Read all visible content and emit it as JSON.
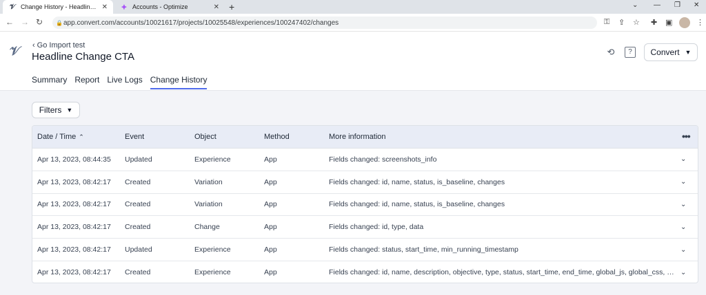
{
  "browser": {
    "tabs": [
      {
        "title": "Change History - Headline Change CTA",
        "active": true
      },
      {
        "title": "Accounts - Optimize",
        "active": false
      }
    ],
    "new_tab": "+",
    "url": "app.convert.com/accounts/10021617/projects/10025548/experiences/100247402/changes"
  },
  "header": {
    "back_label": "Go Import test",
    "title": "Headline Change CTA",
    "convert_button": "Convert"
  },
  "tabs": [
    {
      "label": "Summary",
      "active": false
    },
    {
      "label": "Report",
      "active": false
    },
    {
      "label": "Live Logs",
      "active": false
    },
    {
      "label": "Change History",
      "active": true
    }
  ],
  "filters_label": "Filters",
  "table": {
    "columns": [
      "Date / Time",
      "Event",
      "Object",
      "Method",
      "More information"
    ],
    "rows": [
      {
        "date": "Apr 13, 2023, 08:44:35",
        "event": "Updated",
        "object": "Experience",
        "method": "App",
        "info": "Fields changed: screenshots_info"
      },
      {
        "date": "Apr 13, 2023, 08:42:17",
        "event": "Created",
        "object": "Variation",
        "method": "App",
        "info": "Fields changed: id, name, status, is_baseline, changes"
      },
      {
        "date": "Apr 13, 2023, 08:42:17",
        "event": "Created",
        "object": "Variation",
        "method": "App",
        "info": "Fields changed: id, name, status, is_baseline, changes"
      },
      {
        "date": "Apr 13, 2023, 08:42:17",
        "event": "Created",
        "object": "Change",
        "method": "App",
        "info": "Fields changed: id, type, data"
      },
      {
        "date": "Apr 13, 2023, 08:42:17",
        "event": "Updated",
        "object": "Experience",
        "method": "App",
        "info": "Fields changed: status, start_time, min_running_timestamp"
      },
      {
        "date": "Apr 13, 2023, 08:42:17",
        "event": "Created",
        "object": "Experience",
        "method": "App",
        "info": "Fields changed: id, name, description, objective, type, status, start_time, end_time, global_js, global_css, url..."
      }
    ]
  },
  "colors": {
    "accent": "#4f6bed",
    "table_header_bg": "#e8ecf6",
    "page_bg": "#f3f4f8"
  }
}
